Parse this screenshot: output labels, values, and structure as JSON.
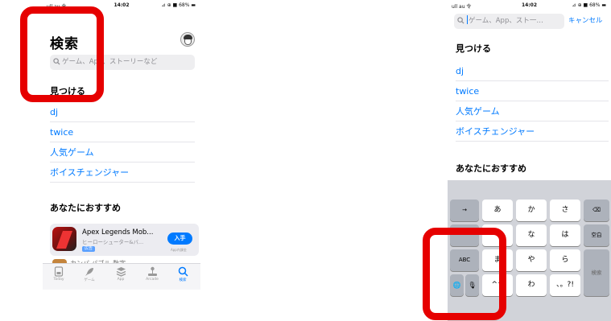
{
  "status_left": {
    "time": "14:02",
    "signal": "ull au 令",
    "battery": "⊿ ⊕ ■ 68% ▬"
  },
  "status_right": {
    "time": "14:02",
    "signal": "ull au 令",
    "battery": "⊿ ⊕ ■ 68% ▬"
  },
  "left": {
    "title": "検索",
    "search_placeholder": "ゲーム、App、ストーリーなど",
    "discover_heading": "見つける",
    "suggestions": [
      "dj",
      "twice",
      "人気ゲーム",
      "ボイスチェンジャー"
    ],
    "recommend_heading": "あなたにおすすめ",
    "app": {
      "name": "Apex Legends Mob...",
      "subtitle": "ヒーローシューター&バ...",
      "ad_badge": "広告",
      "get_label": "入手",
      "note": "App内課金"
    },
    "next_app_peek": "カンパ  パブル  数字",
    "tabs": [
      {
        "label": "Today",
        "icon": "today-icon"
      },
      {
        "label": "ゲーム",
        "icon": "rocket-icon"
      },
      {
        "label": "App",
        "icon": "stack-icon"
      },
      {
        "label": "Arcade",
        "icon": "joystick-icon"
      },
      {
        "label": "検索",
        "icon": "search-icon",
        "active": true
      }
    ]
  },
  "right": {
    "search_placeholder": "ゲーム、App、スト一…",
    "cancel_label": "キャンセル",
    "discover_heading": "見つける",
    "suggestions": [
      "dj",
      "twice",
      "人気ゲーム",
      "ボイスチェンジャー"
    ],
    "recommend_heading": "あなたにおすすめ",
    "keyboard": {
      "row1": [
        "→",
        "あ",
        "か",
        "さ",
        "⌫"
      ],
      "row2": [
        "な",
        "は",
        "空白"
      ],
      "row3": [
        "ABC",
        "ま",
        "や",
        "ら",
        "検索"
      ],
      "row4": [
        "🌐",
        "🎙",
        "^^",
        "わ",
        "、。?!"
      ]
    }
  },
  "colors": {
    "accent": "#007aff",
    "highlight_box": "#e60000",
    "keyboard_bg": "#d1d3d9"
  }
}
